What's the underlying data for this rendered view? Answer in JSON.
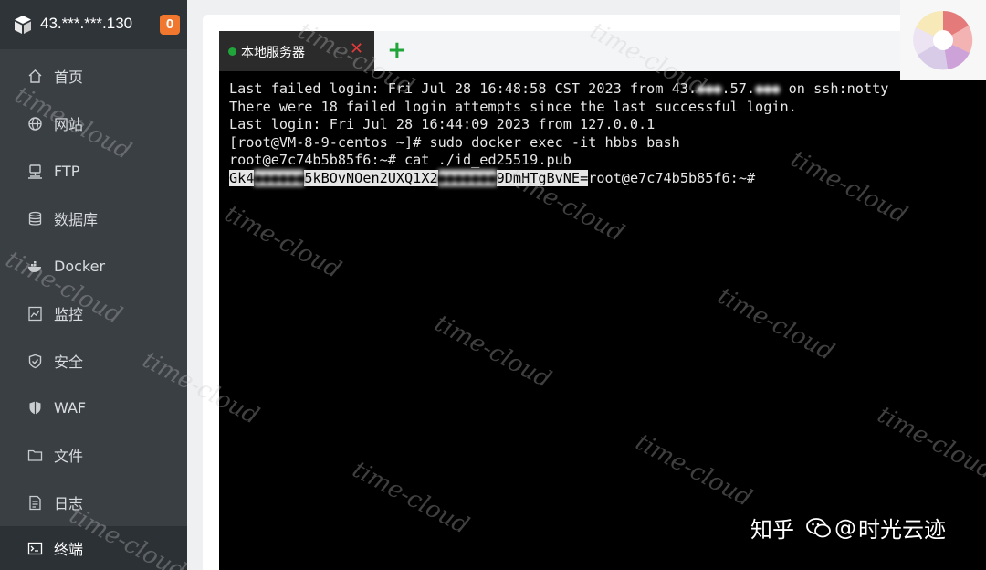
{
  "server": {
    "ip": "43.***.***.130",
    "badge": "0"
  },
  "nav": [
    {
      "label": "首页",
      "icon": "home-icon"
    },
    {
      "label": "网站",
      "icon": "globe-icon"
    },
    {
      "label": "FTP",
      "icon": "ftp-icon"
    },
    {
      "label": "数据库",
      "icon": "database-icon"
    },
    {
      "label": "Docker",
      "icon": "docker-icon"
    },
    {
      "label": "监控",
      "icon": "monitor-icon"
    },
    {
      "label": "安全",
      "icon": "shield-icon"
    },
    {
      "label": "WAF",
      "icon": "waf-shield-icon"
    },
    {
      "label": "文件",
      "icon": "folder-icon"
    },
    {
      "label": "日志",
      "icon": "log-icon"
    },
    {
      "label": "终端",
      "icon": "terminal-icon",
      "active": true
    }
  ],
  "tab": {
    "label": "本地服务器",
    "close": "✕",
    "add": "+"
  },
  "terminal": {
    "line1_a": "Last failed login: Fri Jul 28 16:48:58 CST 2023 from 43.",
    "line1_b": "●●●",
    "line1_c": ".57.",
    "line1_d": "●●●",
    "line1_e": " on ssh:notty",
    "line2": "There were 18 failed login attempts since the last successful login.",
    "line3": "Last login: Fri Jul 28 16:44:09 2023 from 127.0.0.1",
    "line4": "[root@VM-8-9-centos ~]# sudo docker exec -it hbbs bash",
    "line5": "root@e7c74b5b85f6:~# cat ./id_ed25519.pub",
    "line6_a": "Gk4",
    "line6_b": "●●●●●●",
    "line6_c": "5kBOvNOen2UXQ1X2",
    "line6_d": "●●●●●●●",
    "line6_e": "9DmHTgBvNE=",
    "line6_f": "root@e7c74b5b85f6:~#"
  },
  "watermark": "time-cloud",
  "brand": {
    "zhihu": "知乎",
    "at": "@",
    "name": "时光云迹"
  }
}
